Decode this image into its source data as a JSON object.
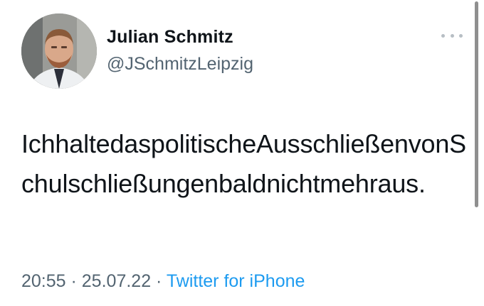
{
  "author": {
    "name": "Julian Schmitz",
    "handle": "@JSchmitzLeipzig"
  },
  "tweet": {
    "text": "IchhaltedaspolitischeAusschließenvonSchulschließungenbaldnichtmehraus.",
    "time": "20:55",
    "separator1": " · ",
    "date": "25.07.22",
    "separator2": " · ",
    "source": "Twitter for iPhone"
  },
  "icons": {
    "more": "more-horizontal-icon"
  },
  "colors": {
    "text": "#0f1419",
    "secondary": "#536471",
    "link": "#1d9bf0"
  }
}
